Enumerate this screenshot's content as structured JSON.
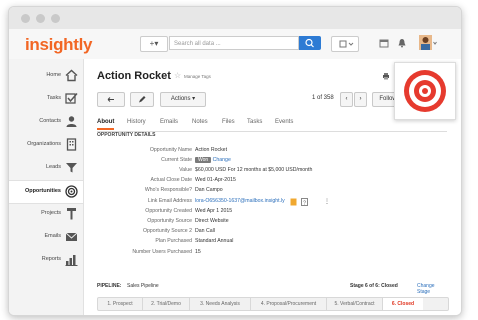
{
  "app": {
    "logo": "insightly",
    "search_placeholder": "Search all data ..."
  },
  "sidebar": {
    "items": [
      {
        "label": "Home",
        "icon": "home-icon"
      },
      {
        "label": "Tasks",
        "icon": "checkbox-icon"
      },
      {
        "label": "Contacts",
        "icon": "person-icon"
      },
      {
        "label": "Organizations",
        "icon": "building-icon"
      },
      {
        "label": "Leads",
        "icon": "funnel-icon"
      },
      {
        "label": "Opportunities",
        "icon": "target-icon"
      },
      {
        "label": "Projects",
        "icon": "hammer-icon"
      },
      {
        "label": "Emails",
        "icon": "envelope-icon"
      },
      {
        "label": "Reports",
        "icon": "bar-chart-icon"
      }
    ]
  },
  "record": {
    "title": "Action Rocket",
    "manage_tags": "Manage Tags",
    "actions_label": "Actions",
    "pager": "1 of 358",
    "follow_label": "Follow"
  },
  "tabs": [
    "About",
    "History",
    "Emails",
    "Notes",
    "Files",
    "Tasks",
    "Events"
  ],
  "details": {
    "section_title": "OPPORTUNITY DETAILS",
    "rows": [
      {
        "label": "Opportunity Name",
        "value": "Action Rocket"
      },
      {
        "label": "Current State",
        "value": "Won",
        "link": "Change"
      },
      {
        "label": "Value",
        "value": "$60,000 USD For 12 months at $5,000 USD/month"
      },
      {
        "label": "Actual Close Date",
        "value": "Wed 01-Apr-2015"
      },
      {
        "label": "Who's Responsible?",
        "value": "Dan Campo"
      },
      {
        "label": "Link Email Address",
        "value": "lora-O656350-1637@mailbox.insight.ly"
      },
      {
        "label": "Opportunity Created",
        "value": "Wed Apr 1 2015"
      },
      {
        "label": "Opportunity Source",
        "value": "Direct Website"
      },
      {
        "label": "Opportunity Source 2",
        "value": "Dan Call"
      },
      {
        "label": "Plan Purchased",
        "value": "Standard Annual"
      },
      {
        "label": "Number Users Purchased",
        "value": "15"
      }
    ]
  },
  "pipeline": {
    "label": "PIPELINE:",
    "name": "Sales Pipeline",
    "stage_text": "Stage 6 of 6: Closed",
    "change_stage": "Change Stage",
    "stages": [
      "1. Prospect",
      "2. Trial/Demo",
      "3. Needs Analysis",
      "4. Proposal/Procurement",
      "5. Verbal/Contract",
      "6. Closed"
    ]
  }
}
